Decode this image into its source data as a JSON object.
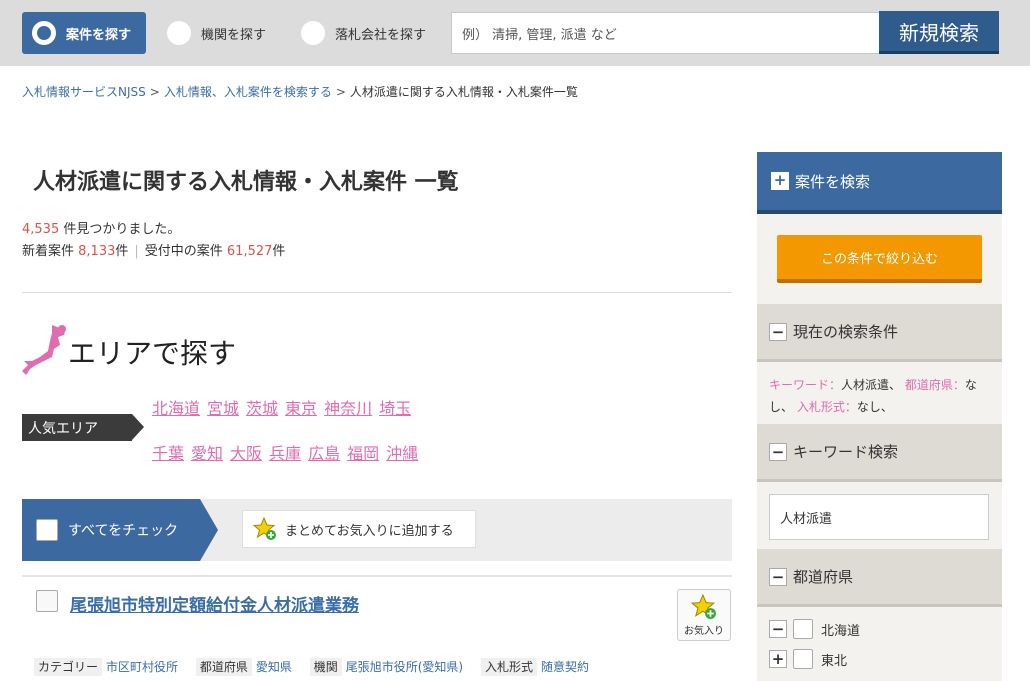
{
  "search": {
    "tab_cases": "案件を探す",
    "tab_agencies": "機関を探す",
    "tab_winners": "落札会社を探す",
    "placeholder": "例） 清掃, 管理, 派遣 など",
    "new_search": "新規検索"
  },
  "breadcrumb": {
    "items": [
      "入札情報サービスNJSS",
      "入札情報、入札案件を検索する",
      "人材派遣に関する入札情報・入札案件一覧"
    ],
    "separator": ">"
  },
  "title": {
    "keyword": "人材派遣",
    "rest": "に関する入札情報・入札案件 一覧"
  },
  "counts": {
    "found_number": "4,535",
    "found_text": " 件見つかりました。",
    "new_label": "新着案件 ",
    "new_number": "8,133",
    "new_unit": "件",
    "accepting_label": "受付中の案件 ",
    "accepting_number": "61,527",
    "accepting_unit": "件",
    "pipe": "|"
  },
  "area": {
    "title": "エリアで探す",
    "popular_label": "人気エリア",
    "row1": [
      "北海道",
      "宮城",
      "茨城",
      "東京",
      "神奈川",
      "埼玉"
    ],
    "row2": [
      "千葉",
      "愛知",
      "大阪",
      "兵庫",
      "広島",
      "福岡",
      "沖縄"
    ]
  },
  "actions": {
    "check_all": "すべてをチェック",
    "add_all_favorites": "まとめてお気入りに追加する"
  },
  "result": {
    "title": "尾張旭市特別定額給付金人材派遣業務",
    "fav_label": "お気入り",
    "meta": [
      {
        "k": "カテゴリー",
        "v": "市区町村役所"
      },
      {
        "k": "都道府県",
        "v": "愛知県"
      },
      {
        "k": "機関",
        "v": "尾張旭市役所(愛知県)"
      },
      {
        "k": "入札形式",
        "v": "随意契約"
      }
    ]
  },
  "sidebar": {
    "head": "案件を検索",
    "narrow_button": "この条件で絞り込む",
    "current_conditions": "現在の検索条件",
    "cond_keyword_label": "キーワード：",
    "cond_keyword_value": "人材派遣、",
    "cond_pref_label": "都道府県：",
    "cond_pref_value": "なし、",
    "cond_type_label": "入札形式：",
    "cond_type_value": "なし、",
    "keyword_search": "キーワード検索",
    "keyword_value": "人材派遣",
    "prefectures": "都道府県",
    "pref_items": [
      {
        "sign": "−",
        "label": "北海道"
      },
      {
        "sign": "+",
        "label": "東北"
      }
    ]
  },
  "colors": {
    "primary": "#3c6aa0",
    "accent_pink": "#e06db0",
    "count_red": "#d9534f",
    "orange": "#f39800"
  }
}
